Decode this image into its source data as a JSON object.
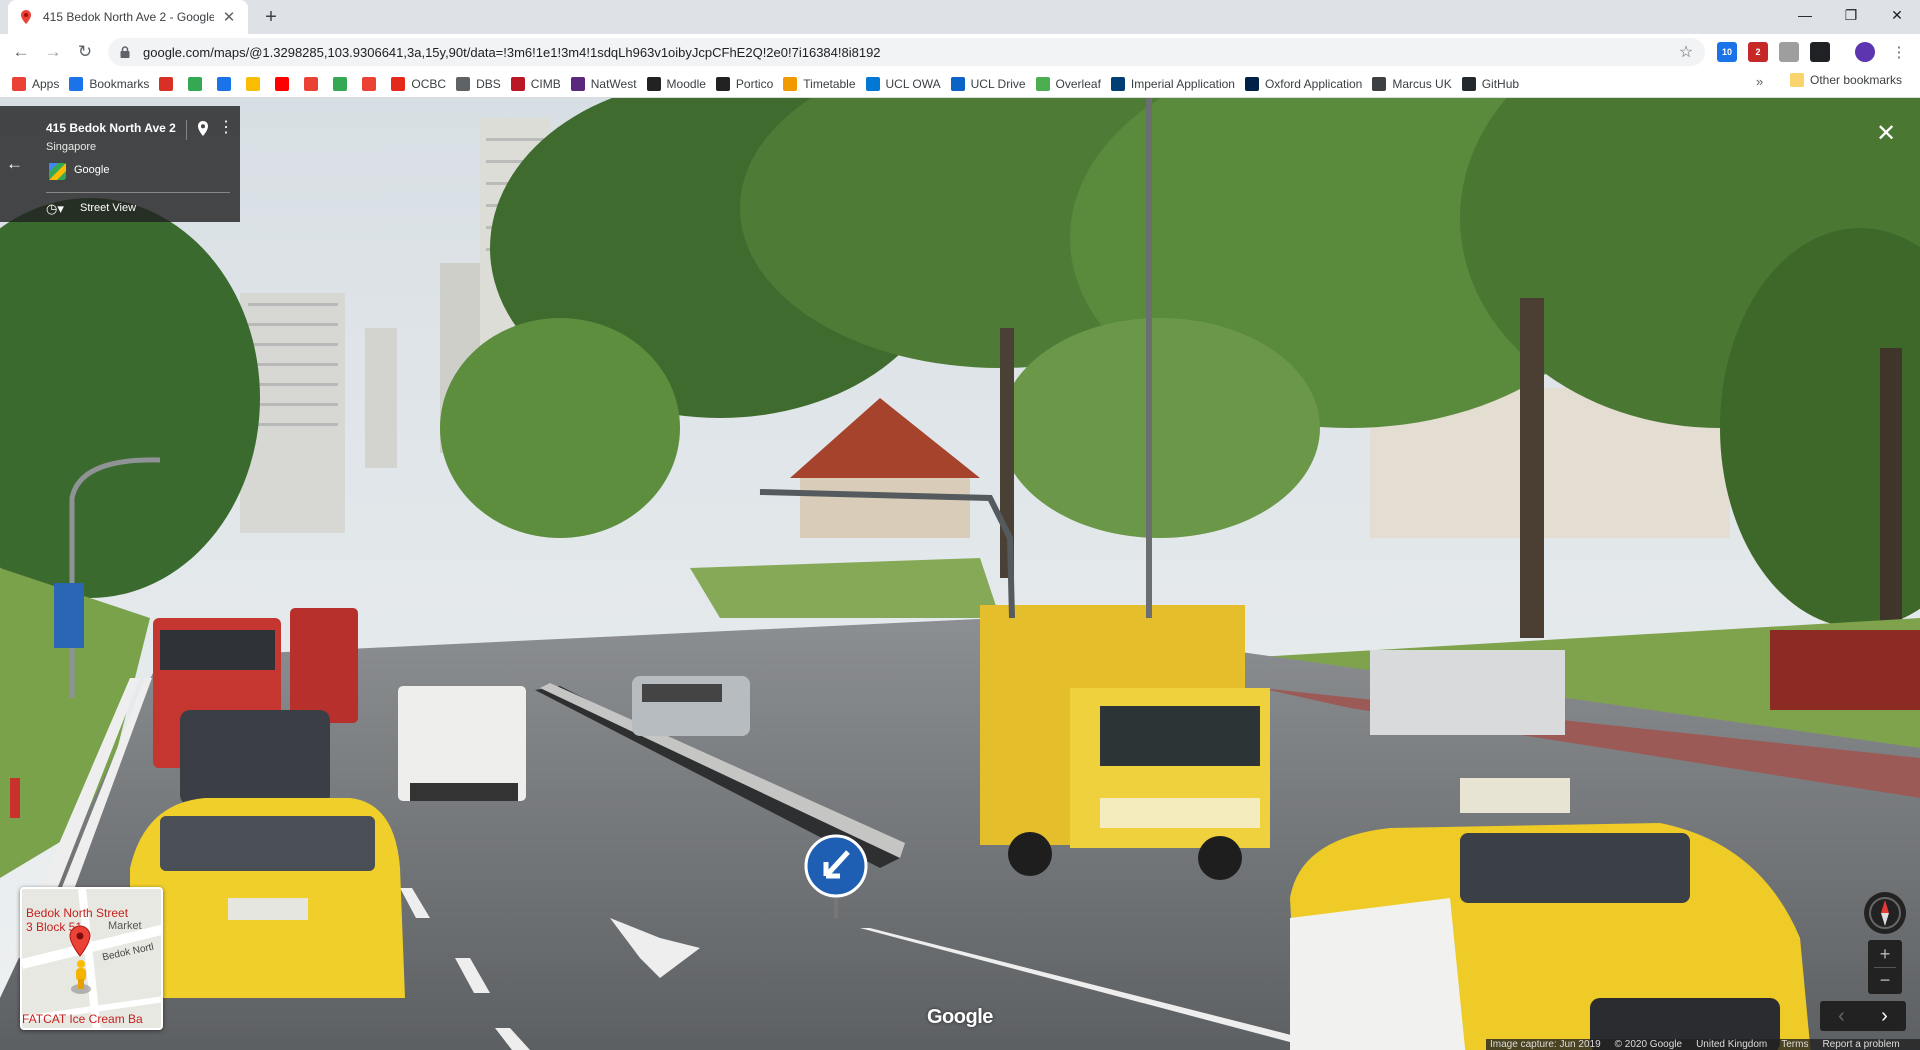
{
  "browser": {
    "tab_title": "415 Bedok North Ave 2 - Google",
    "url": "google.com/maps/@1.3298285,103.9306641,3a,15y,90t/data=!3m6!1e1!3m4!1sdqLh963v1oibyJcpCFhE2Q!2e0!7i16384!8i8192",
    "extension_badges": [
      "10",
      "2"
    ]
  },
  "bookmarks": {
    "items": [
      {
        "label": "Apps",
        "icon": "apps-grid-icon",
        "color": "#ea4335"
      },
      {
        "label": "Bookmarks",
        "icon": "star-icon",
        "color": "#1a73e8"
      },
      {
        "label": "",
        "icon": "gmail-icon",
        "color": "#d93025"
      },
      {
        "label": "",
        "icon": "drive-icon",
        "color": "#34a853"
      },
      {
        "label": "",
        "icon": "calendar-icon",
        "color": "#1a73e8"
      },
      {
        "label": "",
        "icon": "keep-icon",
        "color": "#fbbc04"
      },
      {
        "label": "",
        "icon": "youtube-icon",
        "color": "#ff0000"
      },
      {
        "label": "",
        "icon": "photos-icon",
        "color": "#ea4335"
      },
      {
        "label": "",
        "icon": "maps-icon",
        "color": "#34a853"
      },
      {
        "label": "",
        "icon": "app-icon",
        "color": "#ea4335"
      },
      {
        "label": "OCBC",
        "icon": "ocbc-icon",
        "color": "#e4291b"
      },
      {
        "label": "DBS",
        "icon": "globe-icon",
        "color": "#5f6368"
      },
      {
        "label": "CIMB",
        "icon": "cimb-icon",
        "color": "#ba1826"
      },
      {
        "label": "NatWest",
        "icon": "natwest-icon",
        "color": "#5a287d"
      },
      {
        "label": "Moodle",
        "icon": "moodle-icon",
        "color": "#222222"
      },
      {
        "label": "Portico",
        "icon": "ucl-icon",
        "color": "#222222"
      },
      {
        "label": "Timetable",
        "icon": "timetable-icon",
        "color": "#f29900"
      },
      {
        "label": "UCL OWA",
        "icon": "outlook-icon",
        "color": "#0078d4"
      },
      {
        "label": "UCL Drive",
        "icon": "cloud-icon",
        "color": "#0b63c5"
      },
      {
        "label": "Overleaf",
        "icon": "overleaf-icon",
        "color": "#4cae4f"
      },
      {
        "label": "Imperial Application",
        "icon": "imperial-icon",
        "color": "#003e74"
      },
      {
        "label": "Oxford Application",
        "icon": "oxford-icon",
        "color": "#002147"
      },
      {
        "label": "Marcus UK",
        "icon": "marcus-icon",
        "color": "#3c4043"
      },
      {
        "label": "GitHub",
        "icon": "github-icon",
        "color": "#24292e"
      }
    ],
    "overflow": "»",
    "other": "Other bookmarks"
  },
  "streetview": {
    "title": "415 Bedok North Ave 2",
    "subtitle": "Singapore",
    "provider": "Google",
    "mode": "Street View",
    "minimap": {
      "label1": "Bedok North Street",
      "label2": "3 Block 51",
      "label3": "Market",
      "road": "Bedok Nortl",
      "poi": "FATCAT Ice Cream Ba"
    },
    "logo": "Google",
    "footer": {
      "capture": "Image capture: Jun 2019",
      "copyright": "© 2020 Google",
      "region": "United Kingdom",
      "terms": "Terms",
      "report": "Report a problem"
    }
  }
}
